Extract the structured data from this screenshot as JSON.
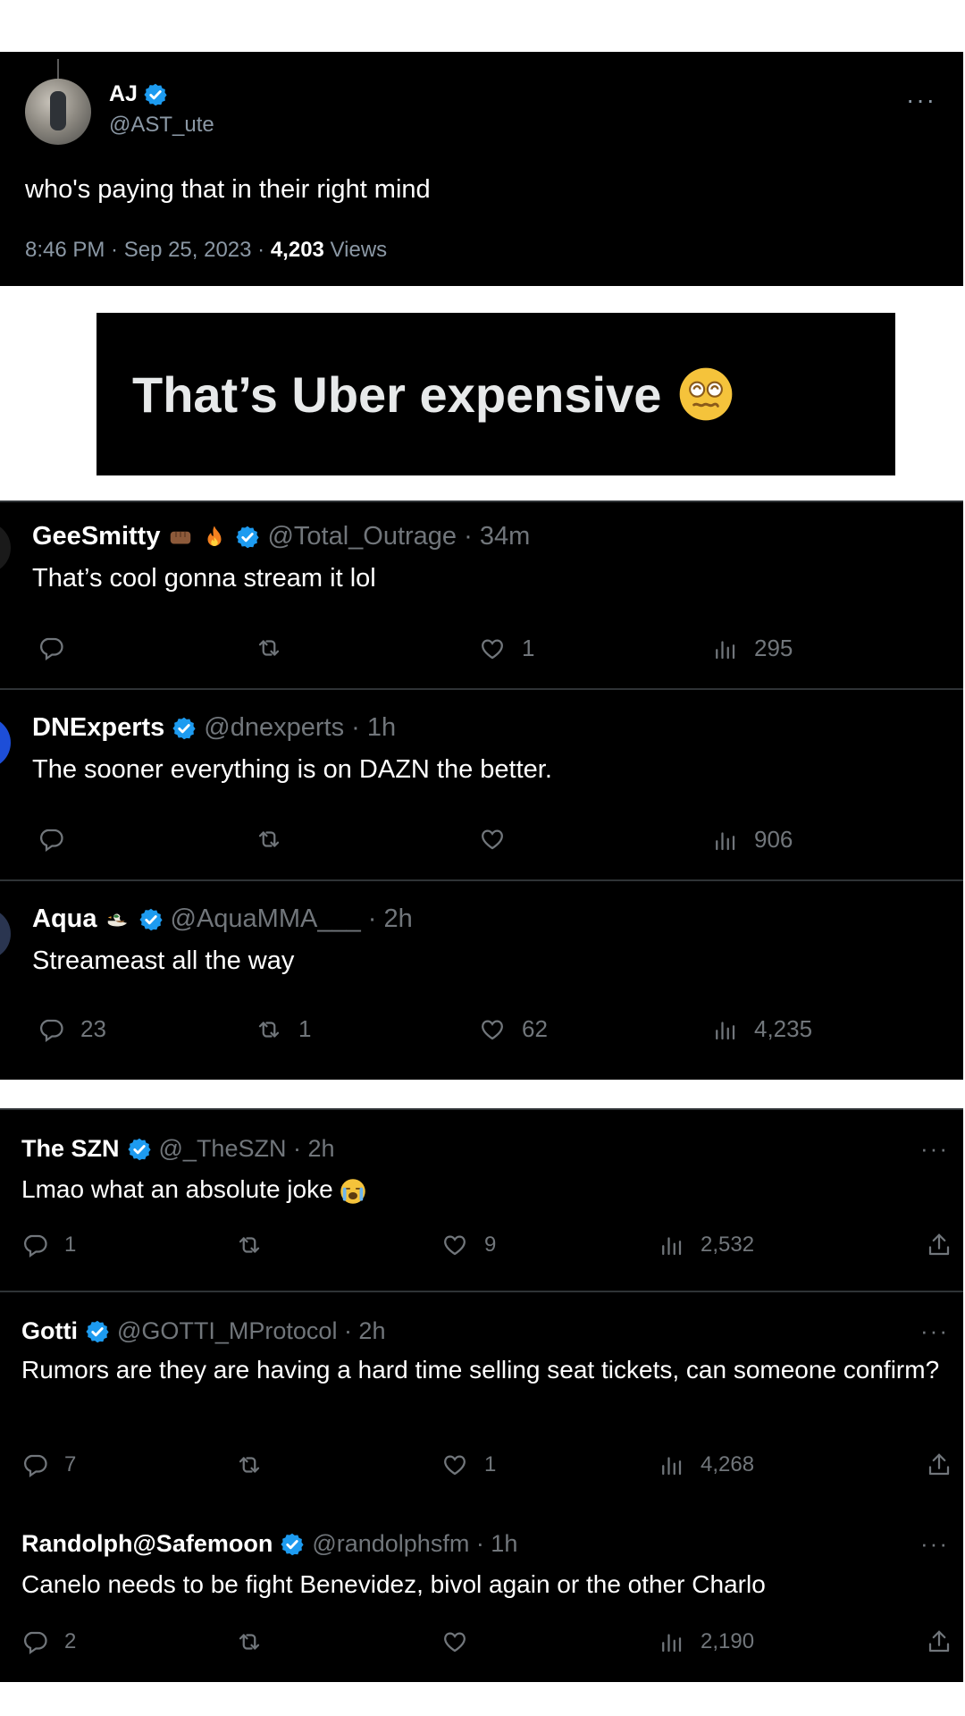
{
  "main_tweet": {
    "name": "AJ",
    "handle": "@AST_ute",
    "text": "who's paying that in their right mind",
    "time": "8:46 PM · Sep 25, 2023 · ",
    "views_count": "4,203",
    "views_label": " Views",
    "more": "···"
  },
  "banner": {
    "text": "That’s Uber expensive"
  },
  "replies_a": [
    {
      "name": "GeeSmitty",
      "handle": "@Total_Outrage · 34m",
      "text": "That’s cool gonna stream it lol",
      "replies": "",
      "retweets": "",
      "likes": "1",
      "views": "295"
    },
    {
      "name": "DNExperts",
      "handle": "@dnexperts · 1h",
      "text": "The sooner everything is on DAZN the better.",
      "replies": "",
      "retweets": "",
      "likes": "",
      "views": "906"
    },
    {
      "name": "Aqua",
      "handle": "@AquaMMA___ · 2h",
      "text": "Streameast all the way",
      "replies": "23",
      "retweets": "1",
      "likes": "62",
      "views": "4,235"
    }
  ],
  "replies_b": [
    {
      "name": "The SZN",
      "handle": "@_TheSZN · 2h",
      "text": "Lmao what an absolute joke",
      "replies": "1",
      "retweets": "",
      "likes": "9",
      "views": "2,532"
    },
    {
      "name": "Gotti",
      "handle": "@GOTTI_MProtocol · 2h",
      "text": "Rumors are they are having a hard time selling seat tickets, can someone confirm?",
      "replies": "7",
      "retweets": "",
      "likes": "1",
      "views": "4,268"
    },
    {
      "name": "Randolph@Safemoon",
      "handle": "@randolphsfm · 1h",
      "text": "Canelo needs to be fight Benevidez, bivol again or the other Charlo",
      "replies": "2",
      "retweets": "",
      "likes": "",
      "views": "2,190"
    }
  ],
  "more": "···",
  "icons": [
    "reply-icon",
    "retweet-icon",
    "like-icon",
    "views-icon",
    "share-icon",
    "verified-badge-icon"
  ],
  "colors": {
    "background": "#000000",
    "text": "#e7e9ea",
    "muted": "#71767b",
    "verified": "#1d9bf0"
  }
}
